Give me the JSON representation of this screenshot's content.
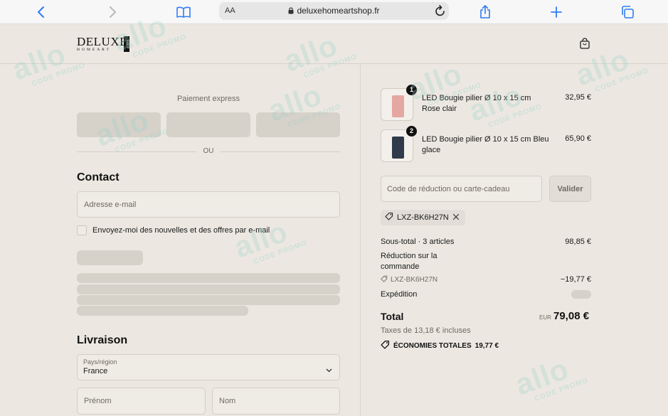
{
  "browser": {
    "text_size_label": "AA",
    "url": "deluxehomeartshop.fr"
  },
  "header": {
    "logo_main": "DELUXE",
    "logo_sub": "HOMEART",
    "logo_side": "SHOP"
  },
  "express": {
    "title": "Paiement express",
    "or_label": "OU"
  },
  "contact": {
    "title": "Contact",
    "email_placeholder": "Adresse e-mail",
    "newsletter_label": "Envoyez-moi des nouvelles et des offres par e-mail"
  },
  "delivery": {
    "title": "Livraison",
    "country_label": "Pays/région",
    "country_value": "France",
    "first_name_placeholder": "Prénom",
    "last_name_placeholder": "Nom"
  },
  "cart": {
    "items": [
      {
        "name": "LED Bougie pilier Ø 10 x 15 cm Rose clair",
        "price": "32,95 €",
        "quantity": "1",
        "color": "#e4a7a2"
      },
      {
        "name": "LED Bougie pilier Ø 10 x 15 cm Bleu glace",
        "price": "65,90 €",
        "quantity": "2",
        "color": "#2f3b4a"
      }
    ]
  },
  "discount": {
    "placeholder": "Code de réduction ou carte-cadeau",
    "apply_label": "Valider",
    "applied_code": "LXZ-BK6H27N"
  },
  "summary": {
    "subtotal_label": "Sous-total · 3 articles",
    "subtotal_value": "98,85 €",
    "discount_label": "Réduction sur la commande",
    "discount_code": "LXZ-BK6H27N",
    "discount_value": "−19,77 €",
    "shipping_label": "Expédition",
    "total_label": "Total",
    "currency": "EUR",
    "total_value": "79,08 €",
    "taxes_label": "Taxes de 13,18 € incluses",
    "savings_label": "ÉCONOMIES TOTALES",
    "savings_value": "19,77 €"
  },
  "watermark": {
    "main": "allo",
    "sub": "CODE PROMO"
  },
  "colors": {
    "background": "#ece8e1",
    "skeleton": "#d6d1c9",
    "ios_blue": "#2f7cf6"
  }
}
